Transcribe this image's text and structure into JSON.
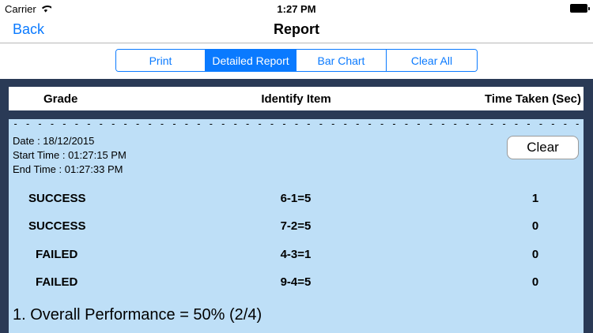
{
  "status": {
    "carrier": "Carrier",
    "time": "1:27 PM"
  },
  "nav": {
    "back_label": "Back",
    "title": "Report"
  },
  "segments": [
    {
      "label": "Print",
      "selected": false
    },
    {
      "label": "Detailed Report",
      "selected": true
    },
    {
      "label": "Bar Chart",
      "selected": false
    },
    {
      "label": "Clear All",
      "selected": false
    }
  ],
  "table": {
    "headers": {
      "grade": "Grade",
      "item": "Identify Item",
      "time": "Time Taken (Sec)"
    }
  },
  "report": {
    "separator": "- - - - - - - - - - - - - - - - - - - - - - - - - - - - - - - - - - - - - - - - - - - - - - - - - - - - - - - - - - - - - - - - - - - - - - - - - - - - - - - - - - - - - - - - - - - - - - - - - - - -",
    "date": "Date : 18/12/2015",
    "start": "Start Time : 01:27:15 PM",
    "end": "End Time : 01:27:33 PM",
    "clear_label": "Clear",
    "rows": [
      {
        "grade": "SUCCESS",
        "item": "6-1=5",
        "time": "1"
      },
      {
        "grade": "SUCCESS",
        "item": "7-2=5",
        "time": "0"
      },
      {
        "grade": "FAILED",
        "item": "4-3=1",
        "time": "0"
      },
      {
        "grade": "FAILED",
        "item": "9-4=5",
        "time": "0"
      }
    ],
    "overall": "1. Overall Performance = 50% (2/4)"
  },
  "colors": {
    "accent": "#0a7aff",
    "panel": "#2a3a56",
    "card": "#bedff7"
  }
}
